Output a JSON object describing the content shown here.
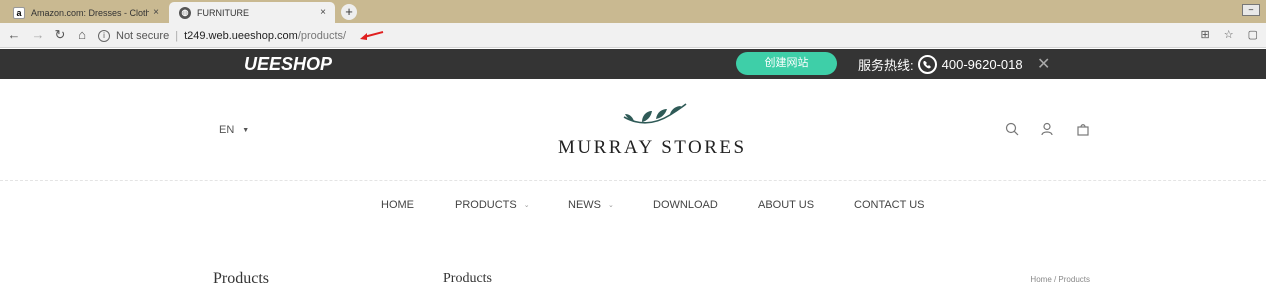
{
  "browser": {
    "tabs": [
      {
        "title": "Amazon.com: Dresses - Clothi",
        "icon": "amazon-favicon",
        "active": false
      },
      {
        "title": "FURNITURE",
        "icon": "globe-favicon",
        "active": true
      }
    ],
    "close_glyph": "×",
    "new_tab_glyph": "+",
    "security_label": "Not secure",
    "url_host": "t249.web.ueeshop.com",
    "url_path": "/products/"
  },
  "site_bar": {
    "brand": "UEESHOP",
    "create_button": "创建网站",
    "hotline_label": "服务热线:",
    "hotline_number": "400-9620-018",
    "accent": "#3ecfa8",
    "background": "#343434"
  },
  "header": {
    "language": "EN",
    "logo_text": "MURRAY STORES",
    "icons": [
      "search-icon",
      "user-icon",
      "cart-icon"
    ]
  },
  "nav": {
    "items": [
      {
        "label": "HOME",
        "has_dropdown": false
      },
      {
        "label": "PRODUCTS",
        "has_dropdown": true
      },
      {
        "label": "NEWS",
        "has_dropdown": true
      },
      {
        "label": "DOWNLOAD",
        "has_dropdown": false
      },
      {
        "label": "ABOUT US",
        "has_dropdown": false
      },
      {
        "label": "CONTACT US",
        "has_dropdown": false
      }
    ]
  },
  "page": {
    "sidebar_title": "Products",
    "title": "Products",
    "breadcrumb": "Home / Products"
  }
}
